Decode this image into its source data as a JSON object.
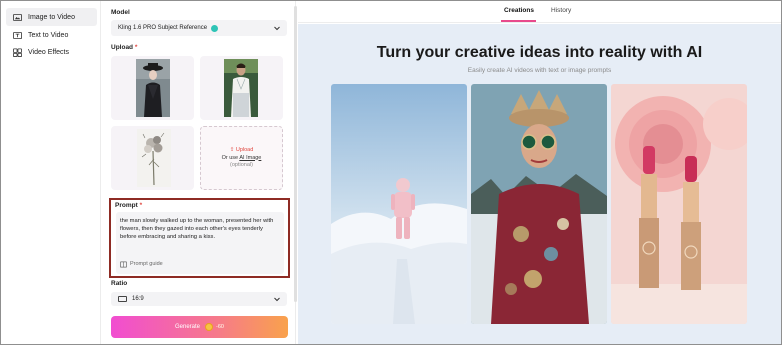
{
  "nav": {
    "items": [
      {
        "label": "Image to Video",
        "icon": "image-video-icon",
        "active": true
      },
      {
        "label": "Text to Video",
        "icon": "text-video-icon",
        "active": false
      },
      {
        "label": "Video Effects",
        "icon": "effects-icon",
        "active": false
      }
    ]
  },
  "form": {
    "model_label": "Model",
    "model_value": "Kling 1.6 PRO Subject Reference",
    "upload_label": "Upload",
    "upload_required": "*",
    "upload_action": "Upload",
    "upload_or": "Or use",
    "upload_ai_image": "AI Image",
    "upload_optional": "(optional)",
    "prompt_label": "Prompt",
    "prompt_required": "*",
    "prompt_text": "the man slowly walked up to the woman, presented her with flowers, then they gazed into each other's eyes tenderly before embracing and sharing a kiss.",
    "prompt_guide": "Prompt guide",
    "ratio_label": "Ratio",
    "ratio_value": "16:9",
    "generate_label": "Generate",
    "generate_cost": "-60"
  },
  "content": {
    "tabs": [
      {
        "label": "Creations",
        "active": true
      },
      {
        "label": "History",
        "active": false
      }
    ],
    "hero_title": "Turn your creative ideas into reality with AI",
    "hero_subtitle": "Easily create AI videos with text or image prompts"
  },
  "colors": {
    "accent_pink": "#e84a8c",
    "required_red": "#e0463f",
    "prompt_highlight": "#8e2b24",
    "generate_gradient_start": "#f14dd1",
    "generate_gradient_end": "#f9a24c"
  }
}
